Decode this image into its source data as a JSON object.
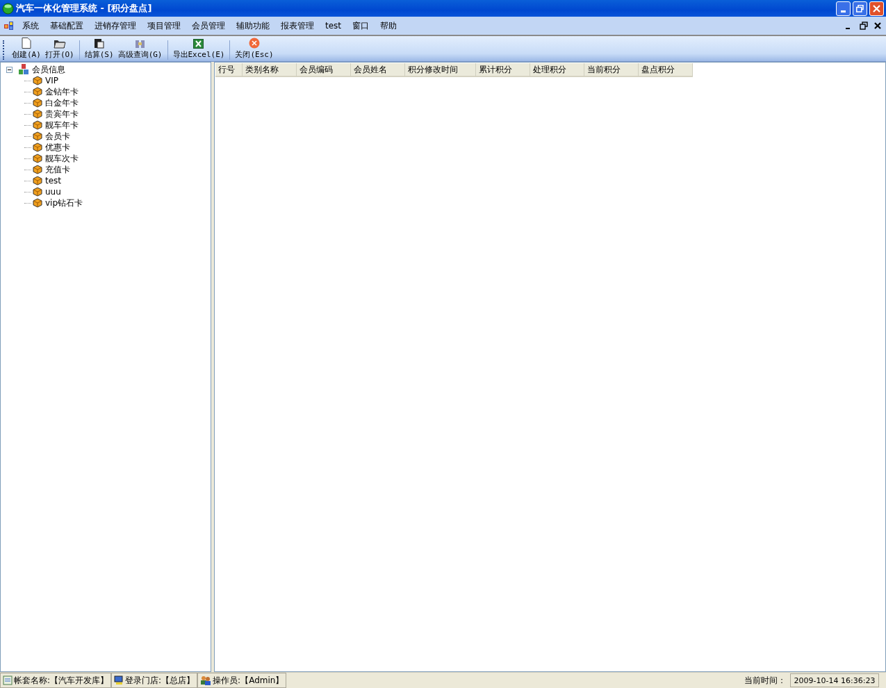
{
  "window": {
    "title": "汽车一体化管理系统 - [积分盘点]"
  },
  "menu": [
    "系统",
    "基础配置",
    "进销存管理",
    "项目管理",
    "会员管理",
    "辅助功能",
    "报表管理",
    "test",
    "窗口",
    "帮助"
  ],
  "toolbar": [
    {
      "label": "创建(A)",
      "kind": "new"
    },
    {
      "label": "打开(O)",
      "kind": "open"
    },
    {
      "kind": "separator"
    },
    {
      "label": "结算(S)",
      "kind": "settle"
    },
    {
      "label": "高级查询(G)",
      "kind": "query"
    },
    {
      "kind": "separator"
    },
    {
      "label": "导出Excel(E)",
      "kind": "excel"
    },
    {
      "kind": "separator"
    },
    {
      "label": "关闭(Esc)",
      "kind": "close"
    }
  ],
  "tree": {
    "label": "会员信息",
    "expanded": true,
    "children": [
      {
        "label": "VIP"
      },
      {
        "label": "金钻年卡"
      },
      {
        "label": "白金年卡"
      },
      {
        "label": "贵宾年卡"
      },
      {
        "label": "靓车年卡"
      },
      {
        "label": "会员卡"
      },
      {
        "label": "优惠卡"
      },
      {
        "label": "靓车次卡"
      },
      {
        "label": "充值卡"
      },
      {
        "label": "test"
      },
      {
        "label": "uuu"
      },
      {
        "label": "vip钻石卡"
      }
    ]
  },
  "table": {
    "columns": [
      "行号",
      "类别名称",
      "会员编码",
      "会员姓名",
      "积分修改时间",
      "累计积分",
      "处理积分",
      "当前积分",
      "盘点积分"
    ]
  },
  "status_bar": {
    "panels": [
      {
        "text": "帐套名称:【汽车开发库】",
        "kind": "book"
      },
      {
        "text": "登录门店:【总店】",
        "kind": "store"
      },
      {
        "text": "操作员:【Admin】",
        "kind": "user"
      }
    ],
    "time_label": "当前时间：",
    "time": "2009-10-14 16:36:23"
  }
}
